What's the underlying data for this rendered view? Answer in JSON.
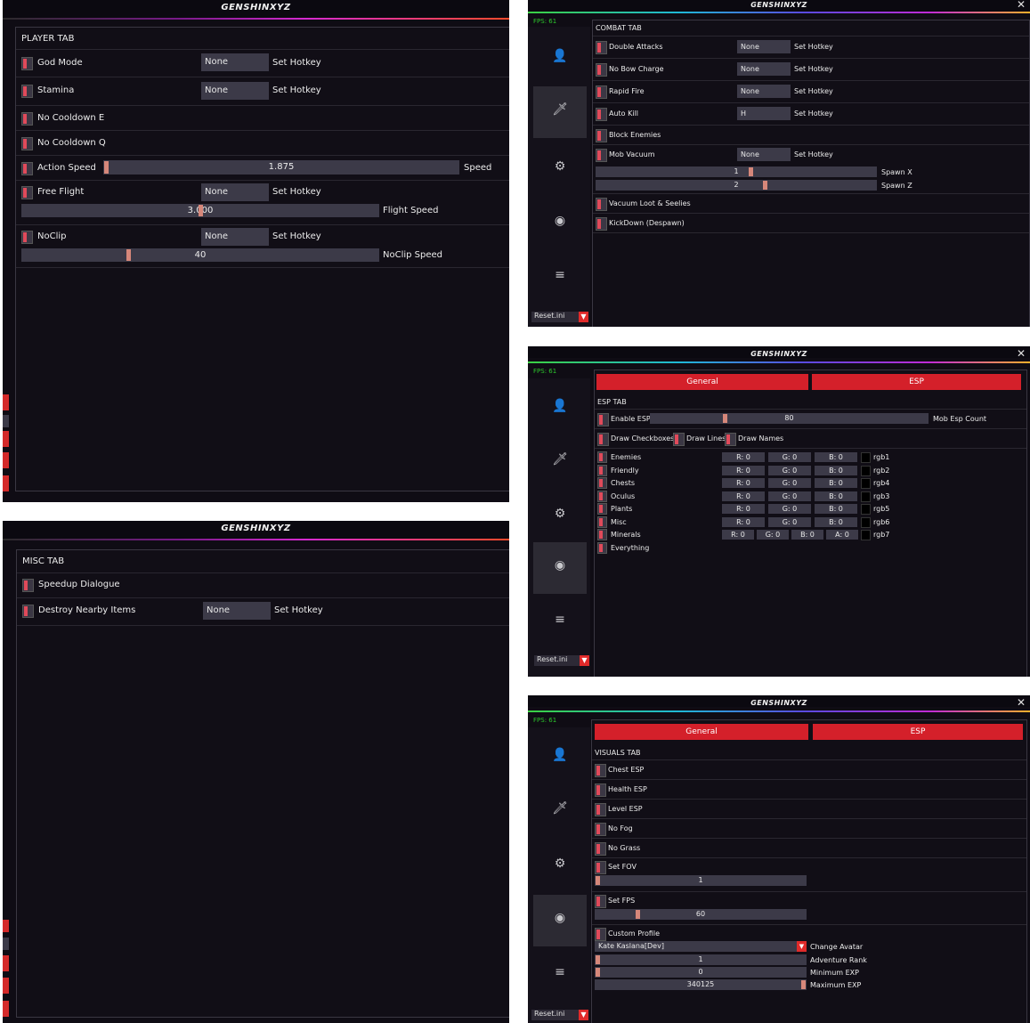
{
  "app_title": "GENSHINXYZ",
  "fps": "FPS: 61",
  "reset": "Reset.ini",
  "set_hotkey": "Set Hotkey",
  "none": "None",
  "player": {
    "section": "PLAYER TAB",
    "god_mode": "God Mode",
    "stamina": "Stamina",
    "no_cd_e": "No Cooldown E",
    "no_cd_q": "No Cooldown Q",
    "action_speed": "Action Speed",
    "action_speed_val": "1.875",
    "speed": "Speed",
    "free_flight": "Free Flight",
    "flight_val": "3.000",
    "flight_speed": "Flight Speed",
    "noclip": "NoClip",
    "noclip_val": "40",
    "noclip_speed": "NoClip Speed"
  },
  "misc": {
    "section": "MISC TAB",
    "speedup": "Speedup Dialogue",
    "destroy": "Destroy Nearby Items"
  },
  "combat": {
    "section": "COMBAT TAB",
    "double": "Double Attacks",
    "nobow": "No Bow Charge",
    "rapid": "Rapid Fire",
    "autokill": "Auto Kill",
    "autokill_key": "H",
    "block": "Block Enemies",
    "mob": "Mob Vacuum",
    "spawn_x_val": "1",
    "spawn_x": "Spawn X",
    "spawn_z_val": "2",
    "spawn_z": "Spawn Z",
    "vacuum_loot": "Vacuum Loot & Seelies",
    "kickdown": "KickDown (Despawn)"
  },
  "tabs": {
    "general": "General",
    "esp": "ESP"
  },
  "esp": {
    "section": "ESP TAB",
    "enable": "Enable ESP",
    "count_val": "80",
    "count": "Mob Esp Count",
    "draw_cb": "Draw Checkboxes",
    "draw_lines": "Draw Lines",
    "draw_names": "Draw Names",
    "rows": [
      {
        "name": "Enemies",
        "r": "R: 0",
        "g": "G: 0",
        "b": "B: 0",
        "tag": "rgb1"
      },
      {
        "name": "Friendly",
        "r": "R: 0",
        "g": "G: 0",
        "b": "B: 0",
        "tag": "rgb2"
      },
      {
        "name": "Chests",
        "r": "R: 0",
        "g": "G: 0",
        "b": "B: 0",
        "tag": "rgb4"
      },
      {
        "name": "Oculus",
        "r": "R: 0",
        "g": "G: 0",
        "b": "B: 0",
        "tag": "rgb3"
      },
      {
        "name": "Plants",
        "r": "R: 0",
        "g": "G: 0",
        "b": "B: 0",
        "tag": "rgb5"
      },
      {
        "name": "Misc",
        "r": "R: 0",
        "g": "G: 0",
        "b": "B: 0",
        "tag": "rgb6"
      }
    ],
    "minerals": "Minerals",
    "min_r": "R: 0",
    "min_g": "G: 0",
    "min_b": "B: 0",
    "min_a": "A: 0",
    "min_tag": "rgb7",
    "everything": "Everything"
  },
  "visuals": {
    "section": "VISUALS TAB",
    "chest": "Chest ESP",
    "health": "Health ESP",
    "level": "Level ESP",
    "nofog": "No Fog",
    "nograss": "No Grass",
    "fov": "Set FOV",
    "fov_val": "1",
    "fps": "Set FPS",
    "fps_val": "60",
    "custom": "Custom Profile",
    "profile": "Kate Kaslana[Dev]",
    "change_avatar": "Change Avatar",
    "rank_val": "1",
    "rank": "Adventure Rank",
    "minexp_val": "0",
    "minexp": "Minimum EXP",
    "maxexp_val": "340125",
    "maxexp": "Maximum EXP"
  }
}
